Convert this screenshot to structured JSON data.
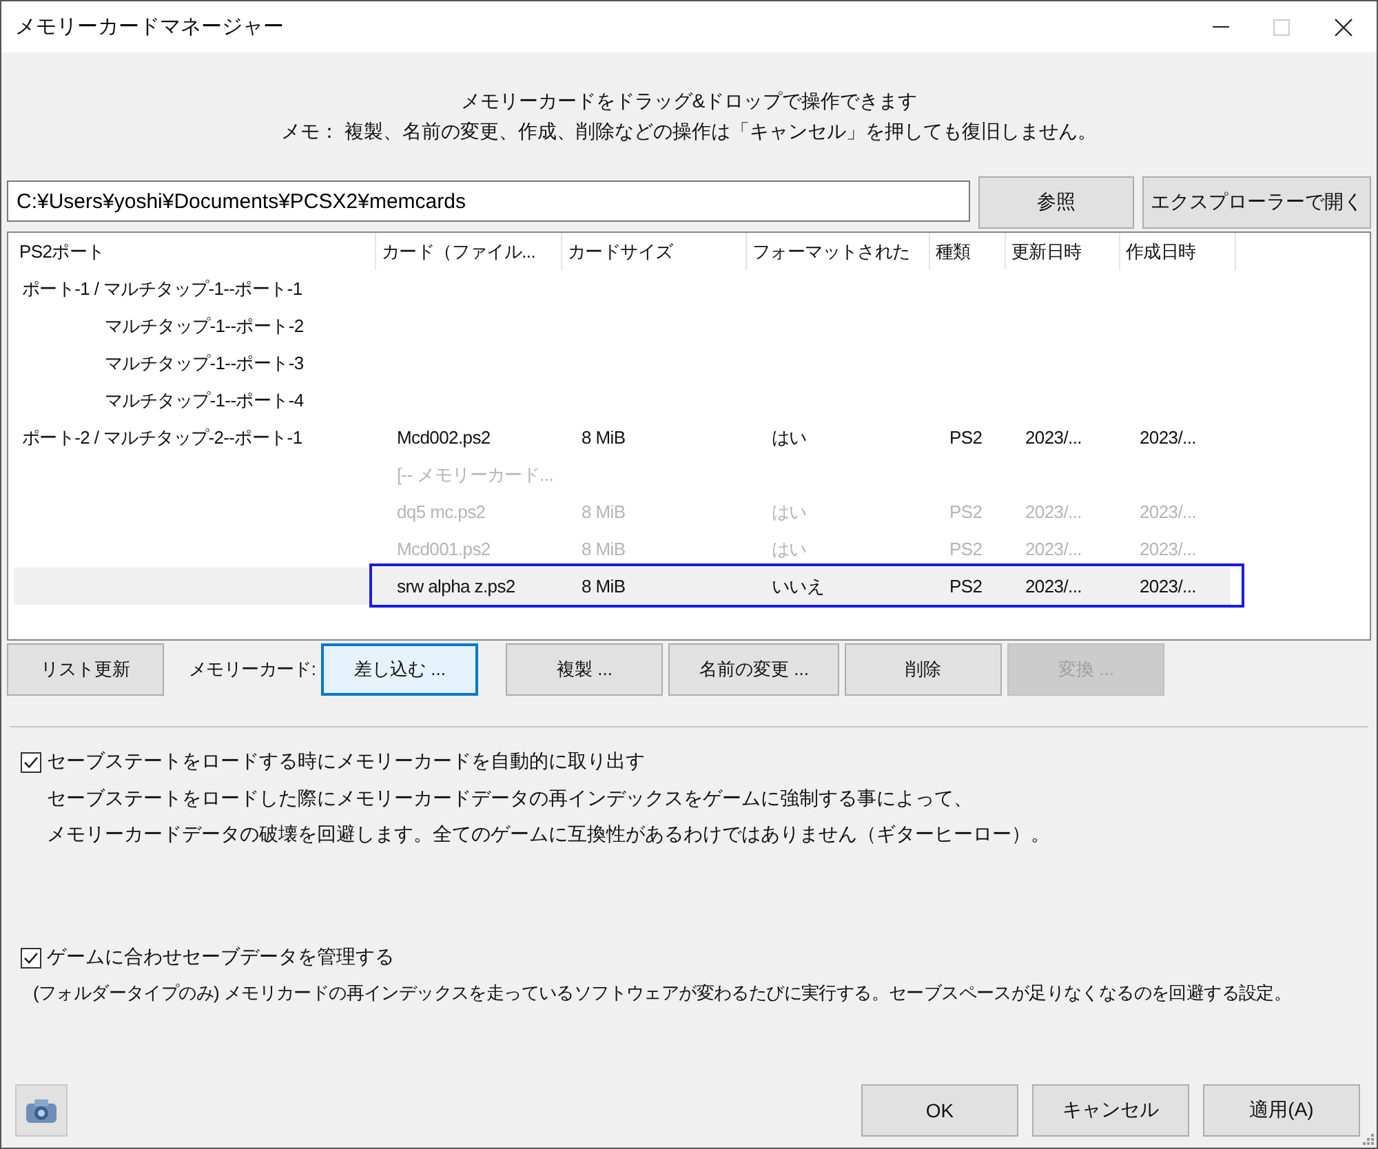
{
  "window": {
    "title": "メモリーカードマネージャー"
  },
  "notice": [
    "メモリーカードをドラッグ&ドロップで操作できます",
    "メモ： 複製、名前の変更、作成、削除などの操作は「キャンセル」を押しても復旧しません。"
  ],
  "path_field": {
    "value": "C:¥Users¥yoshi¥Documents¥PCSX2¥memcards"
  },
  "path_buttons": [
    "参照",
    "エクスプローラーで開く"
  ],
  "table": {
    "columns": [
      "PS2ポート",
      "カード（ファイル...",
      "カードサイズ",
      "フォーマットされた",
      "種類",
      "更新日時",
      "作成日時"
    ],
    "rows": [
      {
        "cells": [
          "ポート-1 / マルチタップ-1--ポート-1",
          "",
          "",
          "",
          "",
          "",
          ""
        ],
        "disabled": false,
        "selected": false,
        "children": [
          {
            "cells": [
              "マルチタップ-1--ポート-2",
              "",
              "",
              "",
              "",
              "",
              ""
            ],
            "disabled": false,
            "selected": false
          },
          {
            "cells": [
              "マルチタップ-1--ポート-3",
              "",
              "",
              "",
              "",
              "",
              ""
            ],
            "disabled": false,
            "selected": false
          },
          {
            "cells": [
              "マルチタップ-1--ポート-4",
              "",
              "",
              "",
              "",
              "",
              ""
            ],
            "disabled": false,
            "selected": false
          }
        ]
      },
      {
        "cells": [
          "ポート-2 / マルチタップ-2--ポート-1",
          "Mcd002.ps2",
          "8 MiB",
          "はい",
          "PS2",
          "2023/...",
          "2023/..."
        ],
        "disabled": false,
        "selected": false
      },
      {
        "cells": [
          "",
          "[-- メモリーカード...",
          "",
          "",
          "",
          "",
          ""
        ],
        "disabled": true,
        "selected": false
      },
      {
        "cells": [
          "",
          "dq5 mc.ps2",
          "8 MiB",
          "はい",
          "PS2",
          "2023/...",
          "2023/..."
        ],
        "disabled": true,
        "selected": false
      },
      {
        "cells": [
          "",
          "Mcd001.ps2",
          "8 MiB",
          "はい",
          "PS2",
          "2023/...",
          "2023/..."
        ],
        "disabled": true,
        "selected": false
      },
      {
        "cells": [
          "",
          "srw alpha z.ps2",
          "8 MiB",
          "いいえ",
          "PS2",
          "2023/...",
          "2023/..."
        ],
        "disabled": false,
        "selected": true
      }
    ]
  },
  "actions": [
    {
      "kind": "button",
      "label": "リスト更新",
      "disabled": false,
      "focused": false
    },
    {
      "kind": "label",
      "label": "メモリーカード:"
    },
    {
      "kind": "button",
      "label": "差し込む ...",
      "disabled": false,
      "focused": true
    },
    {
      "kind": "button",
      "label": "複製 ...",
      "disabled": false,
      "focused": false
    },
    {
      "kind": "button",
      "label": "名前の変更 ...",
      "disabled": false,
      "focused": false
    },
    {
      "kind": "button",
      "label": "削除",
      "disabled": false,
      "focused": false
    },
    {
      "kind": "button",
      "label": "変換 ...",
      "disabled": true,
      "focused": false
    }
  ],
  "options": [
    {
      "label": "セーブステートをロードする時にメモリーカードを自動的に取り出す",
      "checked": true,
      "description": [
        "セーブステートをロードした際にメモリーカードデータの再インデックスをゲームに強制する事によって、",
        "メモリーカードデータの破壊を回避します。全てのゲームに互換性があるわけではありません（ギターヒーロー）。"
      ]
    },
    {
      "label": "ゲームに合わせセーブデータを管理する",
      "checked": true,
      "description": [
        "(フォルダータイプのみ) メモリカードの再インデックスを走っているソフトウェアが変わるたびに実行する。セーブスペースが足りなくなるのを回避する設定。"
      ]
    }
  ],
  "dialog_buttons": [
    "OK",
    "キャンセル",
    "適用(A)"
  ]
}
